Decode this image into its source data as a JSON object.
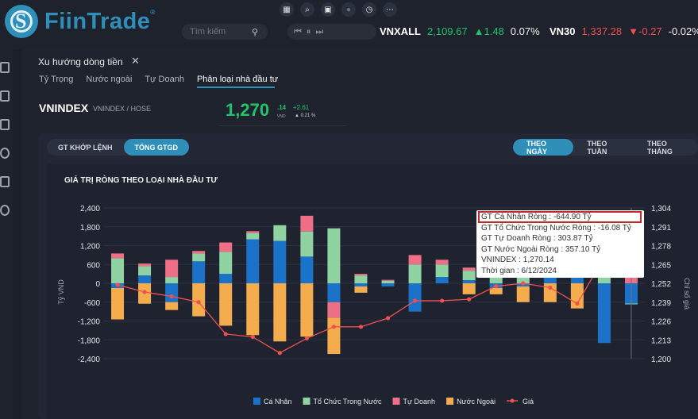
{
  "brand": {
    "name": "FiinTrade",
    "reg": "®"
  },
  "toolbar_icons": [
    "grid-icon",
    "search-circle-icon",
    "briefcase-icon",
    "dot-icon",
    "clock-icon",
    "more-icon"
  ],
  "search": {
    "placeholder": "Tìm kiếm"
  },
  "tickers": [
    {
      "name": "VNXALL",
      "price": "2,109.67",
      "change": "▲1.48",
      "pct": "0.07%",
      "dir": "up"
    },
    {
      "name": "VN30",
      "price": "1,337.28",
      "change": "▼-0.27",
      "pct": "-0.02%",
      "dir": "down"
    }
  ],
  "panel": {
    "title": "Xu hướng dòng tiền",
    "subtabs": [
      "Tỷ Trọng",
      "Nước ngoài",
      "Tự Doanh",
      "Phân loại nhà đầu tư"
    ],
    "active_subtab": 3
  },
  "index": {
    "name": "VNINDEX",
    "sub": "VNINDEX / HOSE",
    "price": "1,270",
    "decimal": ".14",
    "unit": "VND",
    "change": "+2.61",
    "pct": "▲    0.21 %"
  },
  "toggles": {
    "left": [
      "GT KHỚP LỆNH",
      "TỔNG GTGD"
    ],
    "left_active": 1,
    "right": [
      "THEO NGÀY",
      "THEO TUẦN",
      "THEO THÁNG"
    ],
    "right_active": 0
  },
  "chart_data": {
    "type": "bar",
    "title": "GIÁ TRỊ RÒNG THEO LOẠI NHÀ ĐẦU TƯ",
    "ylabel": "Tỷ VND",
    "y2label": "Chỉ số giá",
    "ylim": [
      -2400,
      2400
    ],
    "y2lim": [
      1200,
      1304
    ],
    "yticks": [
      "2,400",
      "1,800",
      "1,200",
      "600",
      "0",
      "-600",
      "-1,200",
      "-1,800",
      "-2,400"
    ],
    "y2ticks": [
      "1,304",
      "1,291",
      "1,278",
      "1,265",
      "1,252",
      "1,239",
      "1,226",
      "1,213",
      "1,200"
    ],
    "stacked": true,
    "colors": {
      "ca_nhan": "#1a73c9",
      "to_chuc": "#8fd3a2",
      "tu_doanh": "#ef6f86",
      "nuoc_ngoai": "#f4ac4d",
      "gia": "#f0504f"
    },
    "series": [
      {
        "name": "Cá Nhân",
        "key": "ca_nhan",
        "values": [
          -150,
          250,
          -600,
          700,
          300,
          1400,
          1350,
          850,
          -600,
          -100,
          -100,
          -900,
          200,
          100,
          -150,
          -100,
          200,
          300,
          -1900,
          -644.9
        ]
      },
      {
        "name": "Tổ Chức Trong Nước",
        "key": "to_chuc",
        "values": [
          800,
          300,
          200,
          250,
          700,
          200,
          500,
          800,
          1750,
          250,
          80,
          600,
          400,
          300,
          200,
          200,
          200,
          100,
          200,
          -16.08
        ]
      },
      {
        "name": "Tự Doanh",
        "key": "tu_doanh",
        "values": [
          150,
          80,
          550,
          80,
          300,
          60,
          0,
          500,
          -500,
          50,
          30,
          300,
          150,
          100,
          80,
          50,
          50,
          150,
          200,
          303.87
        ]
      },
      {
        "name": "Nước Ngoài",
        "key": "nuoc_ngoai",
        "values": [
          -1000,
          -650,
          -250,
          -1050,
          -1350,
          -1650,
          -1850,
          -1700,
          -1150,
          -200,
          0,
          0,
          0,
          -350,
          -200,
          -500,
          -600,
          -800,
          0,
          357.1
        ]
      },
      {
        "name": "Giá",
        "key": "gia",
        "type": "line",
        "values": [
          1251,
          1246,
          1243,
          1239,
          1217,
          1215,
          1204,
          1214,
          1222,
          1222,
          1228,
          1240,
          1240,
          1241,
          1250,
          1252,
          1249,
          1238,
          1270,
          1270.14
        ]
      }
    ],
    "tooltip": {
      "lines": [
        "GT Cá Nhân Ròng  : -644.90 Tỷ",
        "GT Tổ Chức Trong Nước Ròng : -16.08 Tỷ",
        "GT Tự Doanh Ròng : 303.87 Tỷ",
        "GT Nước Ngoài Ròng : 357.10 Tỷ",
        "VNINDEX : 1,270.14",
        "Thời gian : 6/12/2024"
      ]
    }
  }
}
